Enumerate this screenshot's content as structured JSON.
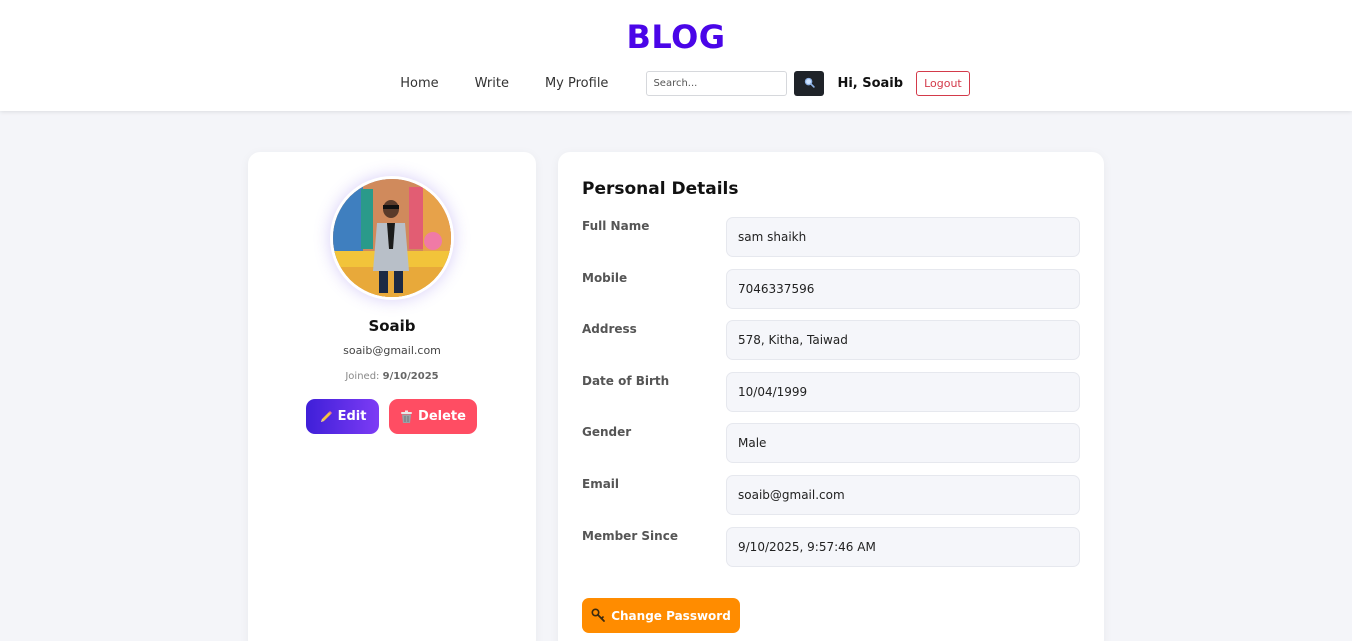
{
  "header": {
    "brand": "BLOG",
    "nav": [
      "Home",
      "Write",
      "My Profile"
    ],
    "search_placeholder": "Search...",
    "greeting": "Hi, Soaib",
    "logout_label": "Logout"
  },
  "profile": {
    "name": "Soaib",
    "email": "soaib@gmail.com",
    "joined_label": "Joined:",
    "joined_date": "9/10/2025",
    "edit_label": "Edit",
    "delete_label": "Delete"
  },
  "details": {
    "title": "Personal Details",
    "fields": [
      {
        "label": "Full Name",
        "value": "sam shaikh"
      },
      {
        "label": "Mobile",
        "value": "7046337596"
      },
      {
        "label": "Address",
        "value": "578, Kitha, Taiwad"
      },
      {
        "label": "Date of Birth",
        "value": "10/04/1999"
      },
      {
        "label": "Gender",
        "value": "Male"
      },
      {
        "label": "Email",
        "value": "soaib@gmail.com"
      },
      {
        "label": "Member Since",
        "value": "9/10/2025, 9:57:46 AM"
      }
    ],
    "change_password_label": "Change Password"
  },
  "icons": {
    "search": "search-icon",
    "edit": "pencil-icon",
    "delete": "trash-icon",
    "change_password": "key-icon"
  },
  "colors": {
    "brand": "#4a05e8",
    "edit_gradient": [
      "#3f1fd8",
      "#7d3cf5"
    ],
    "delete": "#ff4d63",
    "change_password": "#ff8c00",
    "logout": "#d33a4a"
  }
}
